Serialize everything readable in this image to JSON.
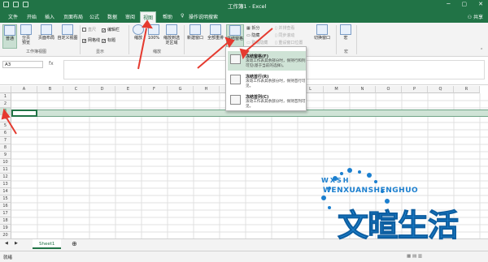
{
  "titlebar": {
    "title": "工作簿1 - Excel"
  },
  "tabs": [
    {
      "label": "文件"
    },
    {
      "label": "开始"
    },
    {
      "label": "插入"
    },
    {
      "label": "页面布局"
    },
    {
      "label": "公式"
    },
    {
      "label": "数据"
    },
    {
      "label": "审阅"
    },
    {
      "label": "视图"
    },
    {
      "label": "帮助"
    },
    {
      "label": "操作说明搜索"
    }
  ],
  "share_label": "共享",
  "ribbon": {
    "workbook_views": {
      "label": "工作簿视图",
      "normal": "普通",
      "page_break": "分页预览",
      "page_layout": "页面布局",
      "custom_views": "自定义视图"
    },
    "show": {
      "label": "显示",
      "ruler": "直尺",
      "gridlines": "网格线",
      "formula_bar": "编辑栏",
      "headings": "标题"
    },
    "zoom": {
      "label": "缩放",
      "zoom": "缩放",
      "hundred": "100%",
      "zoom_selection": "缩放到选定区域"
    },
    "window": {
      "new_window": "新建窗口",
      "arrange_all": "全部重排",
      "freeze_panes": "冻结窗格",
      "split": "拆分",
      "hide": "隐藏",
      "unhide": "取消隐藏",
      "side_by_side": "并排查看",
      "sync_scroll": "同步滚动",
      "reset_position": "重设窗口位置",
      "switch_windows": "切换窗口"
    },
    "macros": {
      "label": "宏",
      "macros": "宏"
    }
  },
  "freeze_menu": [
    {
      "title": "冻结窗格(F)",
      "desc": "滚动工作表其余部分时，保持行和列可见(基于当前的选择)。"
    },
    {
      "title": "冻结首行(R)",
      "desc": "滚动工作表其余部分时，保持首行可见。"
    },
    {
      "title": "冻结首列(C)",
      "desc": "滚动工作表其余部分时，保持首列可见。"
    }
  ],
  "formula_bar": {
    "name_box": "A3",
    "fx": "fx",
    "value": ""
  },
  "columns": [
    "A",
    "B",
    "C",
    "D",
    "E",
    "F",
    "G",
    "H",
    "I",
    "J",
    "K",
    "L",
    "M",
    "N",
    "O",
    "P",
    "Q",
    "R"
  ],
  "rows": [
    "1",
    "2",
    "3",
    "4",
    "5",
    "6",
    "7",
    "8",
    "9",
    "10",
    "11",
    "12",
    "13",
    "14",
    "15",
    "16",
    "17",
    "18",
    "19",
    "20",
    "21"
  ],
  "sheet": {
    "tab": "Sheet1"
  },
  "status": {
    "ready": "就绪"
  },
  "watermark": {
    "pinyin": "WENXUANSHENGHUO",
    "letters": "WXSH",
    "chinese": "文暄生活"
  },
  "colors": {
    "excel_green": "#217346",
    "watermark_blue": "#1f8ad8",
    "arrow_red": "#e53a2f"
  }
}
